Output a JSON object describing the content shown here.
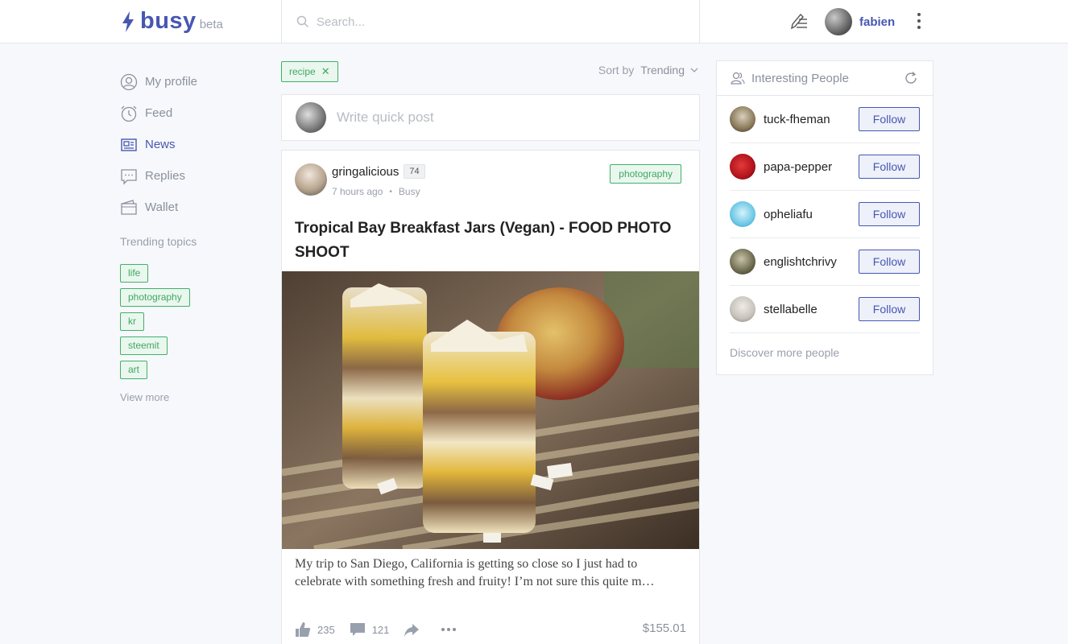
{
  "header": {
    "logo": "busy",
    "beta": "beta",
    "search_placeholder": "Search...",
    "username": "fabien"
  },
  "sidebar": {
    "items": [
      {
        "label": "My profile",
        "icon": "user-circle-icon",
        "active": false
      },
      {
        "label": "Feed",
        "icon": "clock-icon",
        "active": false
      },
      {
        "label": "News",
        "icon": "newspaper-icon",
        "active": true
      },
      {
        "label": "Replies",
        "icon": "chat-icon",
        "active": false
      },
      {
        "label": "Wallet",
        "icon": "wallet-icon",
        "active": false
      }
    ],
    "trending_title": "Trending topics",
    "topics": [
      "life",
      "photography",
      "kr",
      "steemit",
      "art"
    ],
    "view_more": "View more"
  },
  "feed": {
    "filter_tag": "recipe",
    "sort_label": "Sort by",
    "sort_value": "Trending",
    "quick_post_placeholder": "Write quick post",
    "post": {
      "author": "gringalicious",
      "reputation": "74",
      "time": "7 hours ago",
      "app": "Busy",
      "tag": "photography",
      "title": "Tropical Bay Breakfast Jars (Vegan) - FOOD PHOTO SHOOT",
      "body": "My trip to San Diego, California is getting so close so I just had to celebrate with something fresh and fruity! I’m not sure this quite m…",
      "likes": "235",
      "comments": "121",
      "payout": "$155.01"
    }
  },
  "people": {
    "title": "Interesting People",
    "follow_label": "Follow",
    "list": [
      {
        "name": "tuck-fheman",
        "avatar_color": "#8a7a5a"
      },
      {
        "name": "papa-pepper",
        "avatar_color": "#b3141c"
      },
      {
        "name": "opheliafu",
        "avatar_color": "#6fc8e6"
      },
      {
        "name": "englishtchrivy",
        "avatar_color": "#6b6a4e"
      },
      {
        "name": "stellabelle",
        "avatar_color": "#c7c2bb"
      }
    ],
    "discover": "Discover more people"
  },
  "colors": {
    "brand": "#4757b2",
    "tag_green": "#3fb16b",
    "muted": "#99a0ad"
  }
}
